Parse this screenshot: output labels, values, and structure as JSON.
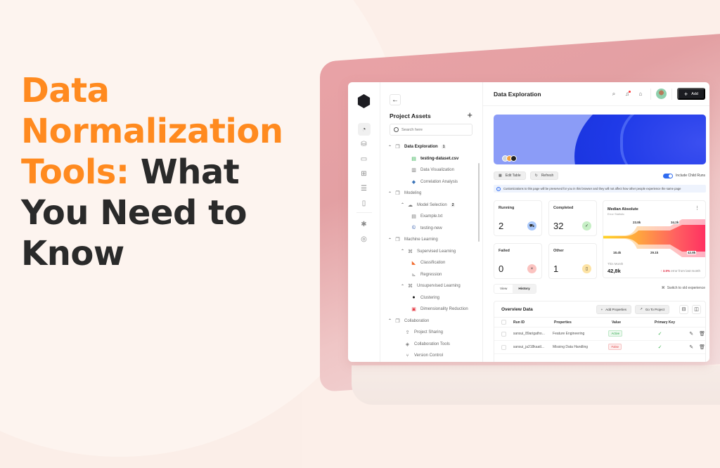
{
  "headline": {
    "line1": "Data",
    "line2": "Normalization",
    "line3_orange": "Tools:",
    "line3_dark": "What",
    "line4": "You Need to",
    "line5": "Know",
    "colors": {
      "accent": "#ff8a1f",
      "dark": "#2a2a2a"
    }
  },
  "app": {
    "rail": {
      "icons": [
        "dashboard-gauge-icon",
        "database-icon",
        "monitor-icon",
        "table-layout-icon",
        "server-icon",
        "file-icon",
        "settings-cog-icon",
        "target-icon"
      ]
    },
    "assets": {
      "title": "Project Assets",
      "search_placeholder": "Search here",
      "tree": [
        {
          "label": "Data Exploration",
          "level": 0,
          "icon": "folder-icon",
          "badge": "1",
          "bold": true,
          "caret": "^"
        },
        {
          "label": "testing-dataset.csv",
          "level": 2,
          "icon": "csv-file-icon",
          "bold": true
        },
        {
          "label": "Data Visualization",
          "level": 2,
          "icon": "layout-icon"
        },
        {
          "label": "Correlation Analysis",
          "level": 2,
          "icon": "python-icon"
        },
        {
          "label": "Modeling",
          "level": 0,
          "icon": "folder-icon",
          "caret": "^"
        },
        {
          "label": "Model Selection",
          "level": 1,
          "icon": "cloud-upload-icon",
          "badge": "2",
          "caret": "^"
        },
        {
          "label": "Example.txt",
          "level": 2,
          "icon": "txt-file-icon"
        },
        {
          "label": "testing-new",
          "level": 2,
          "icon": "c-language-icon"
        },
        {
          "label": "Machine Learning",
          "level": 0,
          "icon": "folder-icon",
          "caret": "^"
        },
        {
          "label": "Supervised Learning",
          "level": 1,
          "icon": "command-icon",
          "caret": "^"
        },
        {
          "label": "Classification",
          "level": 2,
          "icon": "gitlab-icon"
        },
        {
          "label": "Regression",
          "level": 2,
          "icon": "regression-chart-icon"
        },
        {
          "label": "Unsupervised Learning",
          "level": 1,
          "icon": "command-icon",
          "caret": "^"
        },
        {
          "label": "Clustering",
          "level": 2,
          "icon": "github-icon"
        },
        {
          "label": "Dimensionality Reduction",
          "level": 2,
          "icon": "pdf-file-icon"
        },
        {
          "label": "Collaboration",
          "level": 0,
          "icon": "folder-icon",
          "caret": "^"
        },
        {
          "label": "Project Sharing",
          "level": 3,
          "icon": "share-icon"
        },
        {
          "label": "Collaboration Tools",
          "level": 3,
          "icon": "tag-icon"
        },
        {
          "label": "Version Control",
          "level": 3,
          "icon": "git-branch-icon"
        }
      ]
    },
    "topbar": {
      "title": "Data Exploration",
      "add_label": "Add"
    },
    "actions": {
      "edit_table": "Edit Table",
      "refresh": "Refresh",
      "include_child_runs": "Include Child Runs",
      "include_child_runs_on": true
    },
    "info_text": "Customizations to this page will be preserved for you in this browser and they will not affect how other people experience the same page",
    "stats": [
      {
        "label": "Running",
        "value": "2",
        "icon": "running-icon",
        "color": "#a9c8fb"
      },
      {
        "label": "Completed",
        "value": "32",
        "icon": "check-double-icon",
        "color": "#c6efc5"
      },
      {
        "label": "Failed",
        "value": "0",
        "icon": "x-icon",
        "color": "#fbc3c0"
      },
      {
        "label": "Other",
        "value": "1",
        "icon": "document-icon",
        "color": "#fde3a4"
      }
    ],
    "median": {
      "title": "Median Absolute",
      "subtitle": "Error Statistic",
      "labels_top": [
        "23.8k",
        "34.2k"
      ],
      "labels_bottom": [
        "18.4k",
        "29.1k",
        "42.8k"
      ],
      "this_month_label": "This Month",
      "this_month_value": "42,8k",
      "change": "3.5%",
      "change_suffix": "error from last month"
    },
    "tabs": [
      {
        "label": "View",
        "active": false
      },
      {
        "label": "History",
        "active": true
      }
    ],
    "switch_label": "Switch to old experience",
    "overview": {
      "title": "Overview Data",
      "add_properties": "Add Properties",
      "go_to_project": "Go To Project",
      "columns": [
        "Run ID",
        "Properties",
        "Value",
        "Primary Key"
      ],
      "rows": [
        {
          "run_id": "sansui_89arigatho...",
          "property": "Feature Engineering",
          "value": "Active",
          "status": "ok",
          "primary_key": "✓"
        },
        {
          "run_id": "sansui_ja218kaatl...",
          "property": "Missing Data Handling",
          "value": "False",
          "status": "bad",
          "primary_key": "✓"
        }
      ]
    }
  }
}
